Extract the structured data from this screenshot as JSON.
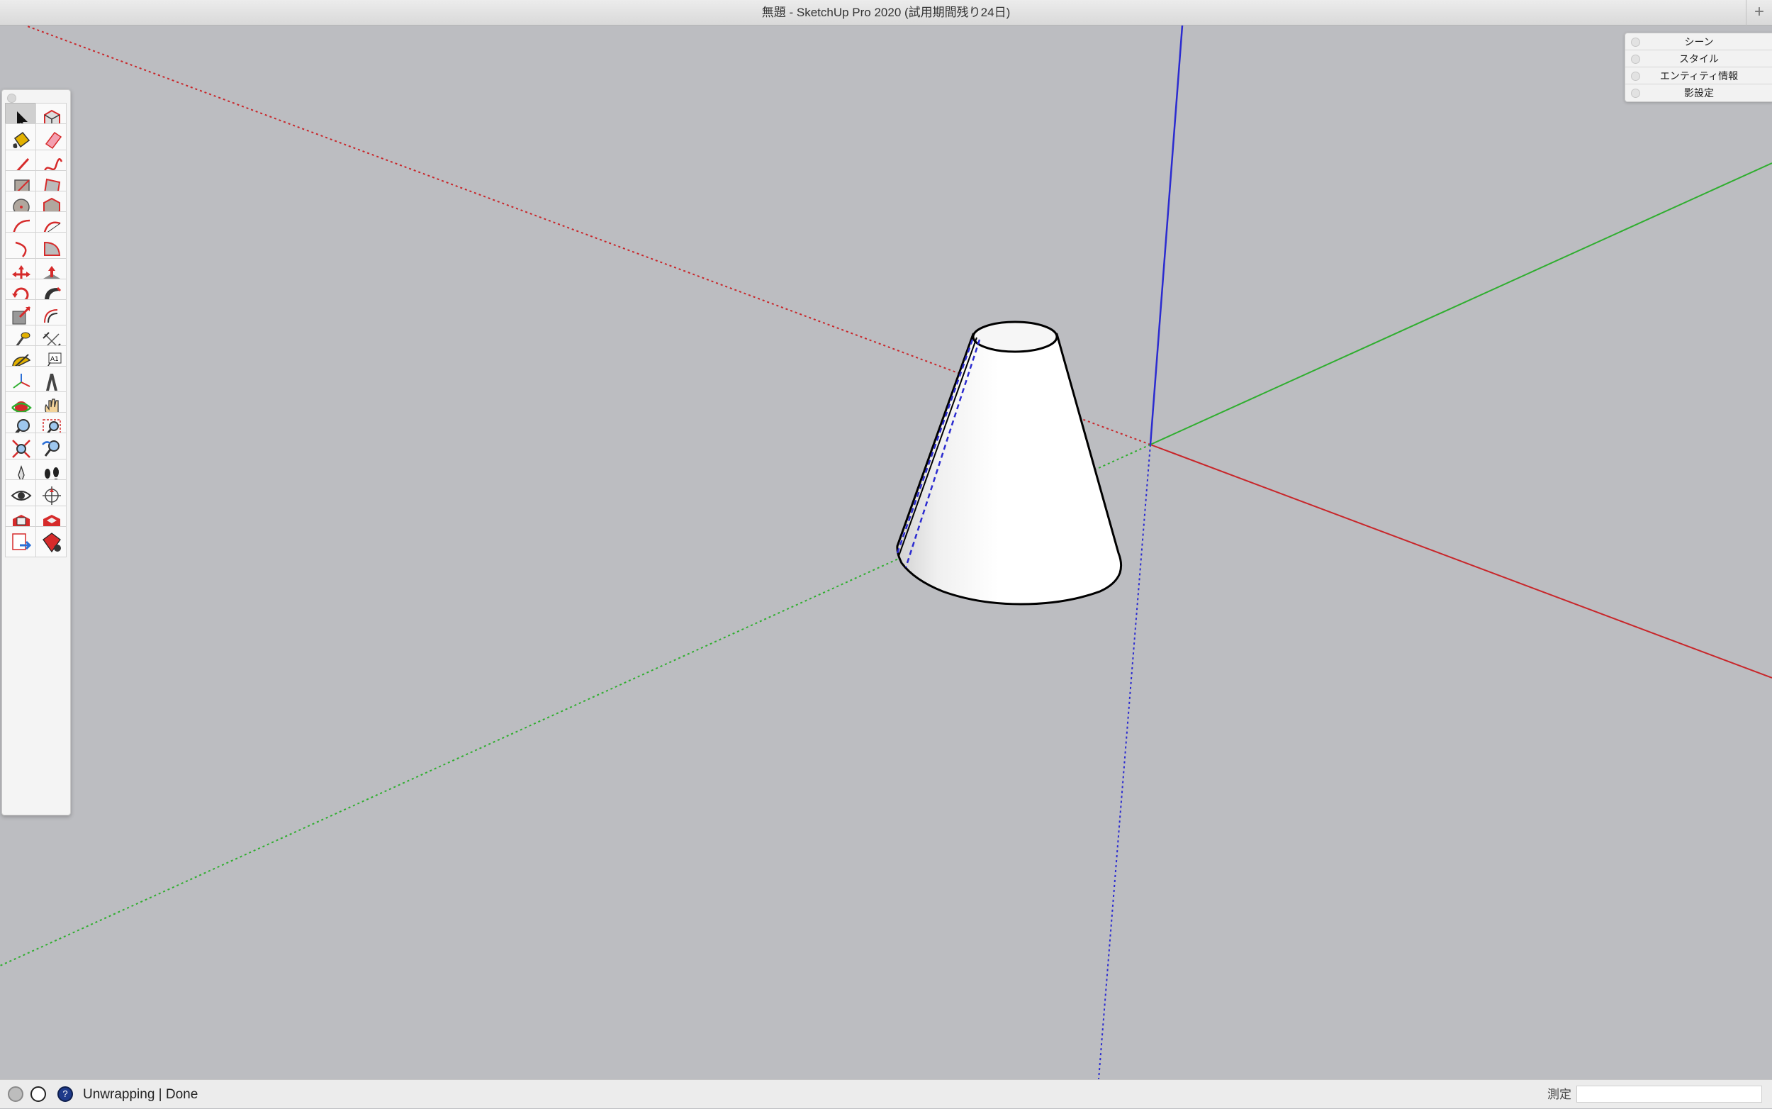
{
  "window": {
    "title": "無題 - SketchUp Pro 2020 (試用期間残り24日)",
    "add_tab_symbol": "+"
  },
  "trays": [
    {
      "label": "シーン"
    },
    {
      "label": "スタイル"
    },
    {
      "label": "エンティティ情報"
    },
    {
      "label": "影設定"
    }
  ],
  "toolbar": {
    "active_tool": "select",
    "tools": [
      {
        "icon": "select-arrow-icon"
      },
      {
        "icon": "make-component-icon"
      },
      {
        "icon": "paint-bucket-icon"
      },
      {
        "icon": "eraser-icon"
      },
      {
        "icon": "line-pencil-icon"
      },
      {
        "icon": "freehand-icon"
      },
      {
        "icon": "rectangle-icon"
      },
      {
        "icon": "rotated-rectangle-icon"
      },
      {
        "icon": "circle-icon"
      },
      {
        "icon": "polygon-icon"
      },
      {
        "icon": "arc-icon"
      },
      {
        "icon": "two-point-arc-icon"
      },
      {
        "icon": "three-point-arc-icon"
      },
      {
        "icon": "pie-icon"
      },
      {
        "icon": "move-icon"
      },
      {
        "icon": "push-pull-icon"
      },
      {
        "icon": "rotate-icon"
      },
      {
        "icon": "follow-me-icon"
      },
      {
        "icon": "scale-icon"
      },
      {
        "icon": "offset-icon"
      },
      {
        "icon": "tape-measure-icon"
      },
      {
        "icon": "dimension-icon"
      },
      {
        "icon": "protractor-icon"
      },
      {
        "icon": "text-label-icon"
      },
      {
        "icon": "axes-icon"
      },
      {
        "icon": "3d-text-icon"
      },
      {
        "icon": "orbit-icon"
      },
      {
        "icon": "pan-icon"
      },
      {
        "icon": "zoom-icon"
      },
      {
        "icon": "zoom-window-icon"
      },
      {
        "icon": "zoom-extents-icon"
      },
      {
        "icon": "previous-view-icon"
      },
      {
        "icon": "position-camera-icon"
      },
      {
        "icon": "walk-icon"
      },
      {
        "icon": "look-around-icon"
      },
      {
        "icon": "section-plane-icon"
      },
      {
        "icon": "3d-warehouse-icon"
      },
      {
        "icon": "extension-warehouse-icon"
      },
      {
        "icon": "layout-send-icon"
      },
      {
        "icon": "extension-manager-icon"
      }
    ]
  },
  "status": {
    "message": "Unwrapping | Done",
    "measurements_label": "測定",
    "measurements_value": ""
  },
  "colors": {
    "background": "#bcbdc1",
    "red_axis": "#c8262a",
    "green_axis": "#2fae2f",
    "blue_axis": "#2b2bd0"
  }
}
